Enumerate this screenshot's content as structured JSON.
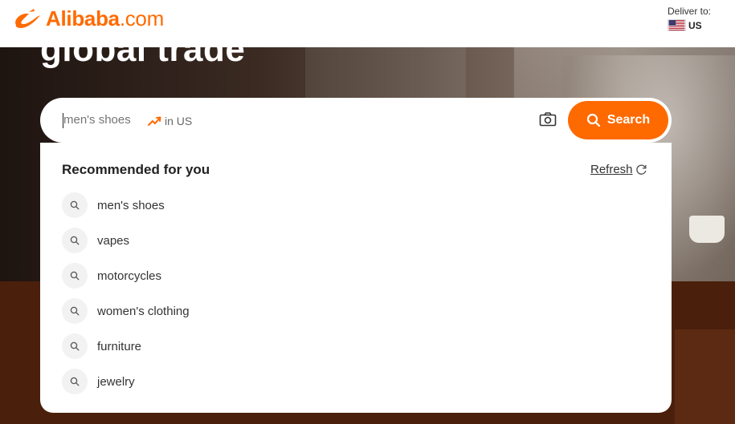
{
  "header": {
    "logo_text": "Alibaba",
    "logo_domain": ".com",
    "deliver_label": "Deliver to:",
    "deliver_country": "US"
  },
  "hero": {
    "title": "global trade"
  },
  "search": {
    "value": "men's shoes",
    "trend_text": "in US",
    "button_label": "Search"
  },
  "dropdown": {
    "title": "Recommended for you",
    "refresh_label": "Refresh",
    "items": [
      {
        "label": "men's shoes"
      },
      {
        "label": "vapes"
      },
      {
        "label": "motorcycles"
      },
      {
        "label": "women's clothing"
      },
      {
        "label": "furniture"
      },
      {
        "label": "jewelry"
      }
    ]
  },
  "colors": {
    "accent": "#ff6a00",
    "text": "#333333"
  }
}
